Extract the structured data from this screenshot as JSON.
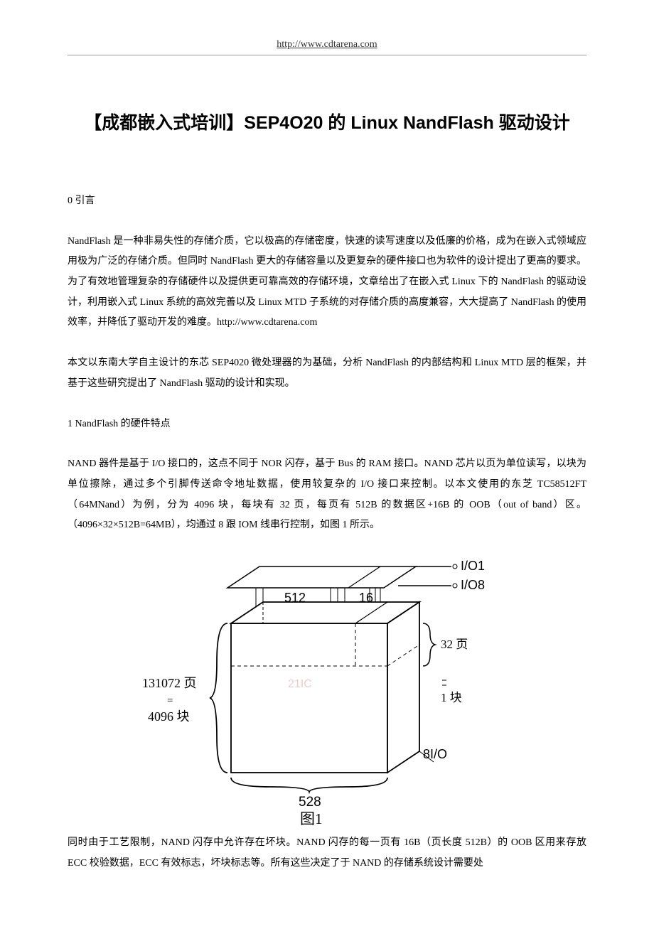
{
  "header": {
    "url": "http://www.cdtarena.com"
  },
  "title": "【成都嵌入式培训】SEP4O20 的 Linux NandFlash 驱动设计",
  "sections": {
    "s0_head": "0  引言",
    "p0": "NandFlash 是一种非易失性的存储介质，它以极高的存储密度，快速的读写速度以及低廉的价格，成为在嵌入式领域应用极为广泛的存储介质。但同时 NandFlash 更大的存储容量以及更复杂的硬件接口也为软件的设计提出了更高的要求。为了有效地管理复杂的存储硬件以及提供更可靠高效的存储环境，文章给出了在嵌入式 Linux 下的 NandFlash 的驱动设计，利用嵌入式 Linux 系统的高效完善以及 Linux MTD 子系统的对存储介质的高度兼容，大大提高了 NandFlash 的使用效率，并降低了驱动开发的难度。http://www.cdtarena.com",
    "p1": "本文以东南大学自主设计的东芯 SEP4020 微处理器的为基础，分析 NandFlash 的内部结构和 Linux MTD 层的框架，并基于这些研究提出了 NandFlash 驱动的设计和实现。",
    "s1_head": "1 NandFlash 的硬件特点",
    "p2": "NAND 器件是基于 I/O 接口的，这点不同于 NOR 闪存，基于 Bus 的 RAM 接口。NAND 芯片以页为单位读写，以块为单位擦除，通过多个引脚传送命令地址数据，使用较复杂的 I/O 接口来控制。以本文使用的东芝 TC58512FT（64MNand）为例，分为 4096 块，每块有 32 页，每页有 512B 的数据区+16B 的 OOB（out of band）区。（4096×32×512B=64MB），均通过 8 跟 IOM 线串行控制，如图 1 所示。",
    "p3": "同时由于工艺限制，NAND 闪存中允许存在坏块。NAND 闪存的每一页有 16B（页长度 512B）的 OOB 区用来存放 ECC 校验数据，ECC 有效标志，坏块标志等。所有这些决定了于 NAND 的存储系统设计需要处"
  },
  "figure": {
    "io1": "I/O1",
    "io8": "I/O8",
    "w512": "512",
    "w16": "16",
    "pages32": "32 页",
    "block1": "1 块",
    "totalpages": "131072 页",
    "eq": "=",
    "totalblocks": "4096 块",
    "io8bottom": "8I/O",
    "width528": "528",
    "caption": "图1",
    "watermark": "21IC"
  }
}
